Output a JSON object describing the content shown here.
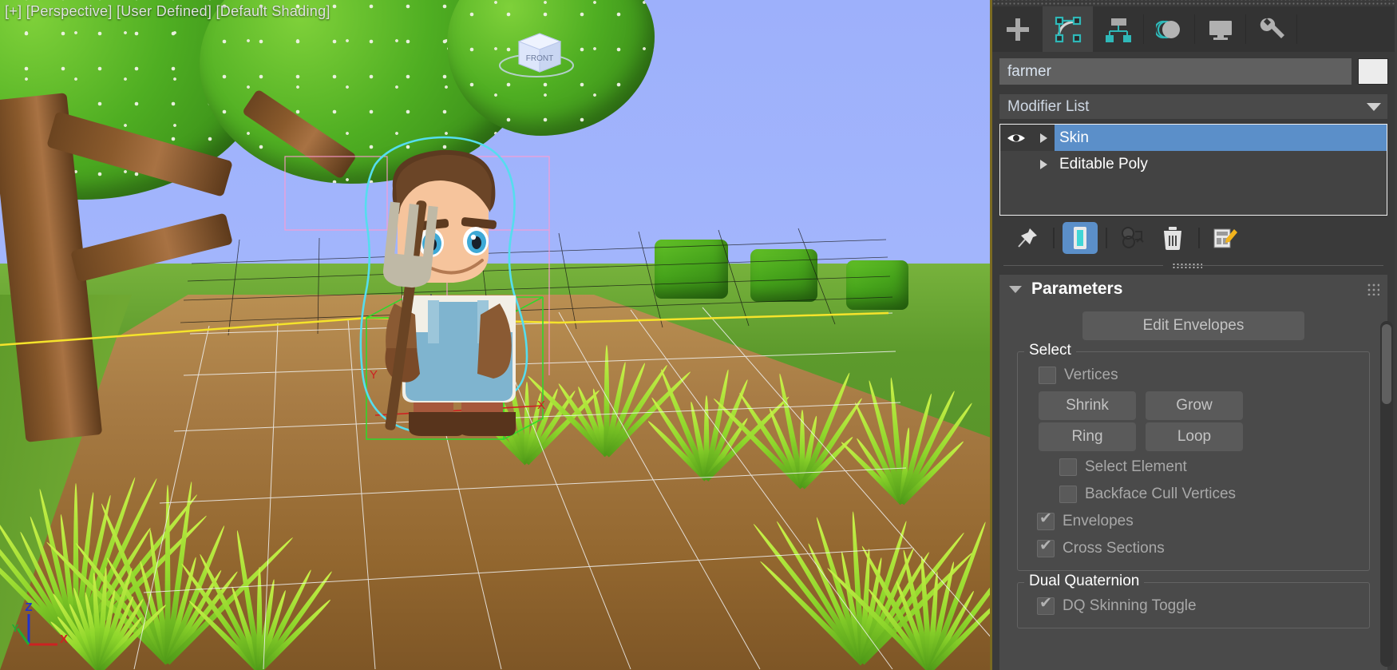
{
  "viewport": {
    "label": "[+] [Perspective] [User Defined] [Default Shading]",
    "viewcube_face": "FRONT",
    "axis_labels": {
      "x": "X",
      "y": "Y",
      "z": "Z"
    },
    "gizmo_axis_labels": {
      "x": "X",
      "y": "Y",
      "z": "Z"
    },
    "colors": {
      "sky": "#9db3fb",
      "grass": "#5d9a2c",
      "road": "#a87c45",
      "selection_outline": "#55ddee",
      "active_viewport_border": "#7a6a22",
      "axis_x": "#cc2222",
      "axis_y": "#22aa33",
      "axis_z": "#2233cc"
    }
  },
  "panel": {
    "tabs": [
      {
        "name": "create-tab",
        "icon": "plus-icon",
        "active": false
      },
      {
        "name": "modify-tab",
        "icon": "modify-icon",
        "active": true
      },
      {
        "name": "hierarchy-tab",
        "icon": "hierarchy-icon",
        "active": false
      },
      {
        "name": "motion-tab",
        "icon": "motion-icon",
        "active": false
      },
      {
        "name": "display-tab",
        "icon": "display-icon",
        "active": false
      },
      {
        "name": "utilities-tab",
        "icon": "wrench-icon",
        "active": false
      }
    ],
    "object_name": "farmer",
    "object_color": "#ececec",
    "modifier_list_label": "Modifier List",
    "stack": [
      {
        "label": "Skin",
        "selected": true,
        "has_eye": true
      },
      {
        "label": "Editable Poly",
        "selected": false,
        "has_eye": false
      }
    ],
    "stack_tools": [
      {
        "name": "pin-stack-icon",
        "active": false
      },
      {
        "name": "show-end-result-icon",
        "active": true
      },
      {
        "name": "make-unique-icon",
        "active": false
      },
      {
        "name": "remove-modifier-icon",
        "active": false
      },
      {
        "name": "configure-modifier-sets-icon",
        "active": false
      }
    ],
    "rollout": {
      "title": "Parameters",
      "edit_envelopes_label": "Edit Envelopes",
      "select_group": {
        "label": "Select",
        "vertices": {
          "label": "Vertices",
          "checked": false
        },
        "shrink_label": "Shrink",
        "grow_label": "Grow",
        "ring_label": "Ring",
        "loop_label": "Loop",
        "select_element": {
          "label": "Select Element",
          "checked": false
        },
        "backface_cull": {
          "label": "Backface Cull Vertices",
          "checked": false
        },
        "envelopes": {
          "label": "Envelopes",
          "checked": true
        },
        "cross_sections": {
          "label": "Cross Sections",
          "checked": true
        }
      },
      "dual_quaternion_group": {
        "label": "Dual Quaternion",
        "dq_toggle": {
          "label": "DQ Skinning Toggle",
          "checked": true
        }
      }
    }
  }
}
